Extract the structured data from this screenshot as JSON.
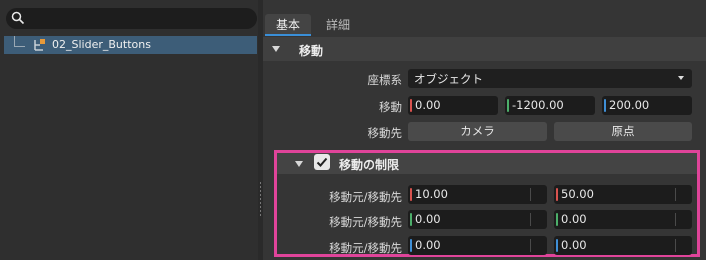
{
  "outliner": {
    "search_placeholder": "",
    "item_label": "02_Slider_Buttons"
  },
  "tabs": [
    {
      "label": "基本"
    },
    {
      "label": "詳細"
    }
  ],
  "transform_section": {
    "title": "移動",
    "coordinate_label": "座標系",
    "coordinate_value": "オブジェクト",
    "move_label": "移動",
    "move_values": [
      "0.00",
      "-1200.00",
      "200.00"
    ],
    "target_label": "移動先",
    "camera_button": "カメラ",
    "origin_button": "原点"
  },
  "limit_section": {
    "title": "移動の制限",
    "enabled": true,
    "rows": [
      {
        "label": "移動元/移動先",
        "min": "10.00",
        "max": "50.00",
        "axis_color": "#d9534f"
      },
      {
        "label": "移動元/移動先",
        "min": "0.00",
        "max": "0.00",
        "axis_color": "#4caf6a"
      },
      {
        "label": "移動元/移動先",
        "min": "0.00",
        "max": "0.00",
        "axis_color": "#3f8fd6"
      }
    ]
  },
  "colors": {
    "axis_x": "#d9534f",
    "axis_y": "#4caf6a",
    "axis_z": "#3f8fd6",
    "highlight_border": "#e0449a",
    "selection": "#3d5d78"
  }
}
